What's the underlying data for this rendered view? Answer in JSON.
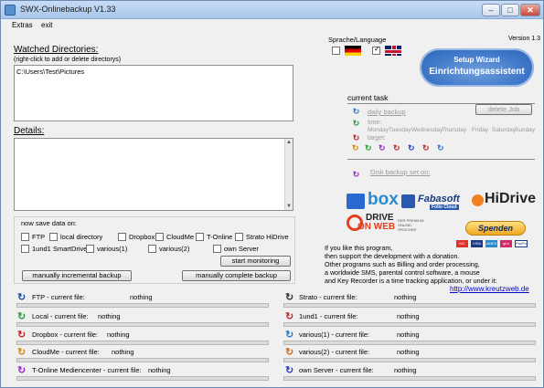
{
  "window": {
    "title": "SWX-Onlinebackup V1.33",
    "min": "–",
    "max": "□",
    "close": "✕"
  },
  "menu": {
    "extras": "Extras",
    "exit": "exit"
  },
  "watched": {
    "heading": "Watched Directories:",
    "hint": "(right-click to add or delete directorys)",
    "paths": [
      "C:\\Users\\Test\\Pictures"
    ]
  },
  "details": {
    "heading": "Details:"
  },
  "save": {
    "label": "now save data on:",
    "options": [
      {
        "label": "FTP",
        "checked": false
      },
      {
        "label": "local directory",
        "checked": false
      },
      {
        "label": "Dropbox",
        "checked": false
      },
      {
        "label": "CloudMe",
        "checked": false
      },
      {
        "label": "T-Online",
        "checked": false
      },
      {
        "label": "Strato HiDrive",
        "checked": false
      },
      {
        "label": "1und1 SmartDrive",
        "checked": false
      },
      {
        "label": "various(1)",
        "checked": false
      },
      {
        "label": "various(2)",
        "checked": false
      },
      {
        "label": "own Server",
        "checked": false
      }
    ],
    "start_monitoring": "start monitoring",
    "incremental": "manually incremental backup",
    "complete": "manually complete backup"
  },
  "language": {
    "label": "Sprache/Language",
    "de_checked": false,
    "en_checked": true
  },
  "version": "Version 1.3",
  "wizard": {
    "line1": "Setup Wizard",
    "line2": "Einrichtungsassistent"
  },
  "task": {
    "heading": "current task",
    "daily": "daily backup",
    "delete": "delete Job",
    "time": "time:",
    "days": [
      "Monday",
      "Tuesday",
      "Wednesday",
      "Thursday",
      "Friday",
      "Saturday",
      "Sunday"
    ],
    "target": "target:",
    "disk": "Disk backup set on:"
  },
  "brands": {
    "box": "box",
    "fabasoft": "Fabasoft",
    "fabasoft_sub": "Folio Cloud",
    "hidrive": "HiDrive",
    "drive": "DRIVE",
    "onweb": "ON WEB",
    "dow_sub": "DER PREMIUM ONLINE-SPEICHER"
  },
  "donate": {
    "button": "Spenden",
    "cards": [
      "MC",
      "VISA",
      "AMEX",
      "giro",
      "PayPal"
    ]
  },
  "info": {
    "lines": [
      "If you like this program,",
      "then support the development with a donation.",
      "Other programs such as Billing and order processing,",
      "a worldwide SMS, parental control software, a mouse",
      "and Key Recorder is a time tracking application, or under it:"
    ],
    "link": "http://www.kreutzweb.de"
  },
  "status": [
    {
      "name": "FTP - current file:",
      "value": "nothing",
      "color": "#1a4fa8"
    },
    {
      "name": "Strato - current file:",
      "value": "nothing",
      "color": "#333333"
    },
    {
      "name": "Local - current file:",
      "value": "nothing",
      "color": "#2a9a3a"
    },
    {
      "name": "1und1 - current file:",
      "value": "nothing",
      "color": "#c0282a"
    },
    {
      "name": "Dropbox - current file:",
      "value": "nothing",
      "color": "#c0282a"
    },
    {
      "name": "various(1) - current file:",
      "value": "nothing",
      "color": "#2a7acc"
    },
    {
      "name": "CloudMe - current file:",
      "value": "nothing",
      "color": "#d08a1a"
    },
    {
      "name": "various(2) - current file:",
      "value": "nothing",
      "color": "#d06a1a"
    },
    {
      "name": "T-Online Mediencenter - current file:",
      "value": "nothing",
      "color": "#9a2ad0"
    },
    {
      "name": "own Server - current file:",
      "value": "nothing",
      "color": "#2a3acc"
    }
  ]
}
